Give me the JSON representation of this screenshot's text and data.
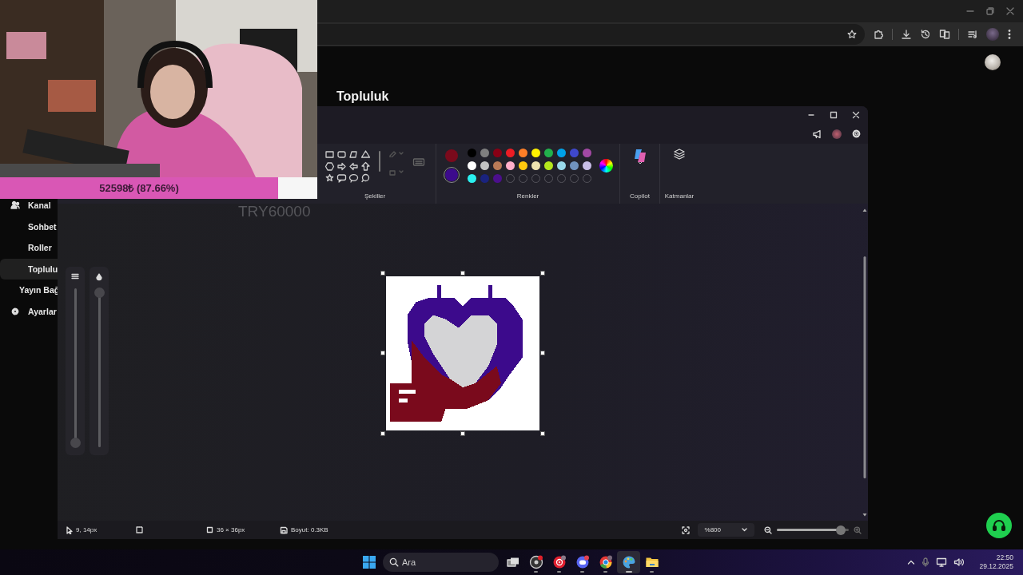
{
  "browser": {
    "sidebar": [
      {
        "label": "Kanal",
        "selected": false
      },
      {
        "label": "Sohbet",
        "selected": false
      },
      {
        "label": "Roller",
        "selected": false
      },
      {
        "label": "Toplulu",
        "selected": true
      },
      {
        "label": "Yayın Bağ",
        "selected": false
      },
      {
        "label": "Ayarlar",
        "selected": false
      }
    ],
    "page_title": "Topluluk"
  },
  "paint": {
    "sections": [
      "Şekiller",
      "Renkler",
      "Copilot",
      "Katmanlar"
    ],
    "current_colors": [
      {
        "color": "#7a0a1c",
        "selected": false
      },
      {
        "color": "#3c0a8c",
        "selected": true
      }
    ],
    "swatches": [
      {
        "kind": "swatch",
        "color": "#000000"
      },
      {
        "kind": "swatch",
        "color": "#7f7f7f"
      },
      {
        "kind": "swatch",
        "color": "#880015"
      },
      {
        "kind": "swatch",
        "color": "#ed1c24"
      },
      {
        "kind": "swatch",
        "color": "#ff7f27"
      },
      {
        "kind": "swatch",
        "color": "#fff200"
      },
      {
        "kind": "swatch",
        "color": "#22b14c"
      },
      {
        "kind": "swatch",
        "color": "#00a2e8"
      },
      {
        "kind": "swatch",
        "color": "#3f48cc"
      },
      {
        "kind": "swatch",
        "color": "#a349a4"
      },
      {
        "kind": "swatch",
        "color": "#ffffff"
      },
      {
        "kind": "swatch",
        "color": "#c3c3c3"
      },
      {
        "kind": "swatch",
        "color": "#b97a57"
      },
      {
        "kind": "swatch",
        "color": "#ffaec9"
      },
      {
        "kind": "swatch",
        "color": "#ffc90e"
      },
      {
        "kind": "swatch",
        "color": "#efe4b0"
      },
      {
        "kind": "swatch",
        "color": "#b5e61d"
      },
      {
        "kind": "swatch",
        "color": "#99d9ea"
      },
      {
        "kind": "swatch",
        "color": "#7092be"
      },
      {
        "kind": "swatch",
        "color": "#c8bfe7"
      },
      {
        "kind": "swatch",
        "color": "#2af0f0"
      },
      {
        "kind": "swatch",
        "color": "#1a237e"
      },
      {
        "kind": "swatch",
        "color": "#4b0f8c"
      },
      {
        "kind": "empty"
      },
      {
        "kind": "empty"
      },
      {
        "kind": "empty"
      },
      {
        "kind": "empty"
      },
      {
        "kind": "empty"
      },
      {
        "kind": "empty"
      },
      {
        "kind": "empty"
      }
    ],
    "brush_sliders": [
      {
        "level": 0
      },
      {
        "level": 1
      }
    ],
    "status_bar": {
      "cursor_position": "9, 14px",
      "canvas_size": "36 × 36px",
      "file_size": "Boyut: 0.3KB",
      "zoom": "%800"
    },
    "zoom_slider": {
      "level": 0.92
    }
  },
  "stream_overlay": {
    "goal_text": "TRY60000",
    "donation_bar": {
      "text": "52598₺ (87.66%)",
      "level": 0.8766
    }
  },
  "taskbar": {
    "search": {
      "placeholder": "Ara"
    },
    "apps": [
      {
        "kind": "record",
        "selected": false
      },
      {
        "kind": "music",
        "selected": false
      },
      {
        "kind": "chat",
        "selected": false
      },
      {
        "kind": "browser",
        "selected": false
      },
      {
        "kind": "paint",
        "selected": true
      },
      {
        "kind": "folder",
        "selected": false
      }
    ],
    "time": "22:50",
    "date": "29.12.2025"
  }
}
